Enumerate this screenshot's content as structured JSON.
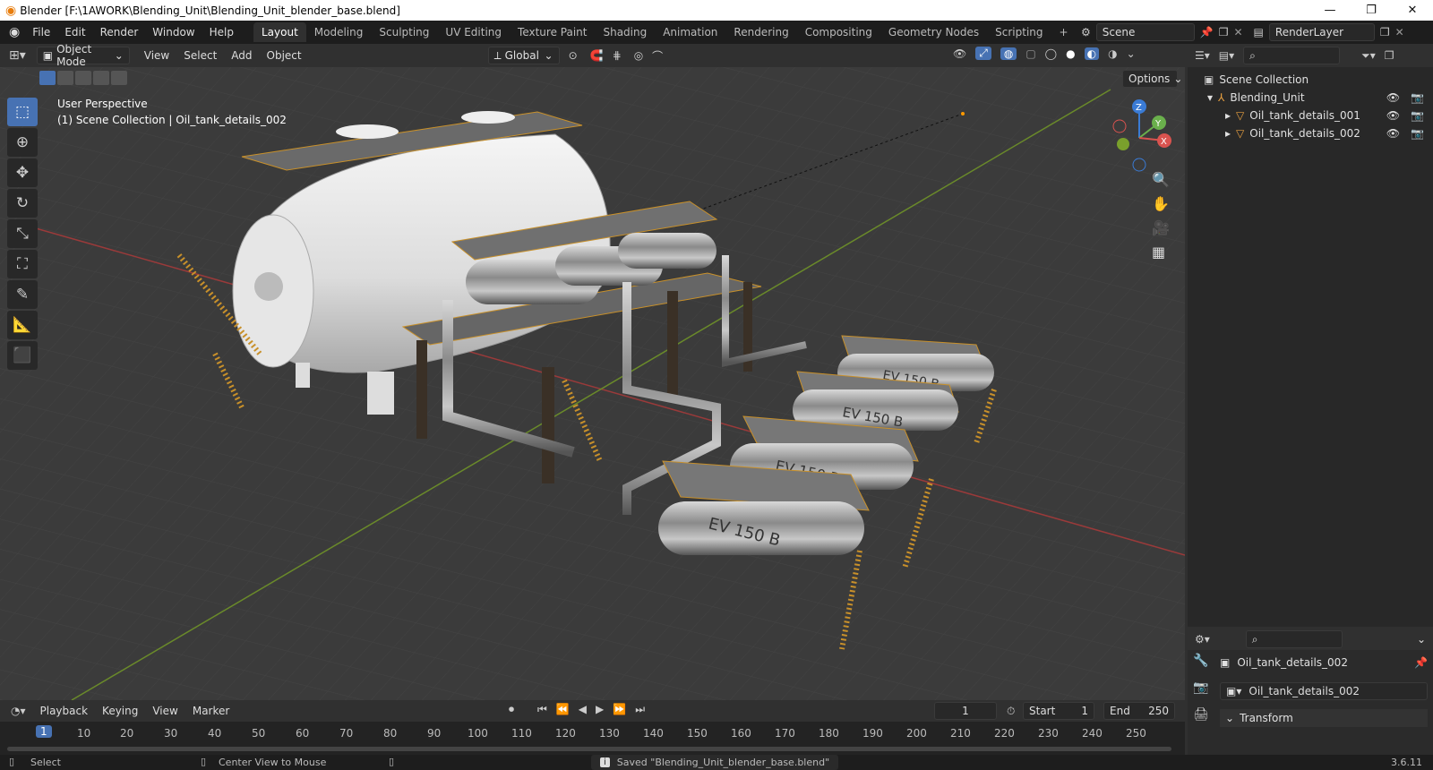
{
  "window": {
    "title": "Blender [F:\\1AWORK\\Blending_Unit\\Blending_Unit_blender_base.blend]",
    "controls": [
      "—",
      "❐",
      "✕"
    ]
  },
  "menu": {
    "items": [
      "File",
      "Edit",
      "Render",
      "Window",
      "Help"
    ]
  },
  "workspaces": {
    "tabs": [
      "Layout",
      "Modeling",
      "Sculpting",
      "UV Editing",
      "Texture Paint",
      "Shading",
      "Animation",
      "Rendering",
      "Compositing",
      "Geometry Nodes",
      "Scripting"
    ],
    "active": "Layout",
    "add": "+"
  },
  "scene": {
    "name": "Scene"
  },
  "renderlayer": {
    "name": "RenderLayer"
  },
  "viewport": {
    "mode": "Object Mode",
    "menus": [
      "View",
      "Select",
      "Add",
      "Object"
    ],
    "orientation": "Global",
    "options": "Options",
    "perspective": "User Perspective",
    "context": "(1) Scene Collection | Oil_tank_details_002",
    "tank_label": "EV 150 B",
    "axes": {
      "x": "X",
      "y": "Y",
      "z": "Z"
    }
  },
  "outliner": {
    "root": "Scene Collection",
    "collection": "Blending_Unit",
    "objects": [
      "Oil_tank_details_001",
      "Oil_tank_details_002"
    ]
  },
  "properties": {
    "object_name": "Oil_tank_details_002",
    "data_name": "Oil_tank_details_002",
    "section": "Transform"
  },
  "timeline": {
    "menus": [
      "Playback",
      "Keying",
      "View",
      "Marker"
    ],
    "current_frame": "1",
    "start_label": "Start",
    "start": "1",
    "end_label": "End",
    "end": "250",
    "ruler": [
      "1",
      "10",
      "20",
      "30",
      "40",
      "50",
      "60",
      "70",
      "80",
      "90",
      "100",
      "110",
      "120",
      "130",
      "140",
      "150",
      "160",
      "170",
      "180",
      "190",
      "200",
      "210",
      "220",
      "230",
      "240",
      "250"
    ]
  },
  "status": {
    "select": "Select",
    "center": "Center View to Mouse",
    "message": "Saved \"Blending_Unit_blender_base.blend\"",
    "version": "3.6.11"
  }
}
